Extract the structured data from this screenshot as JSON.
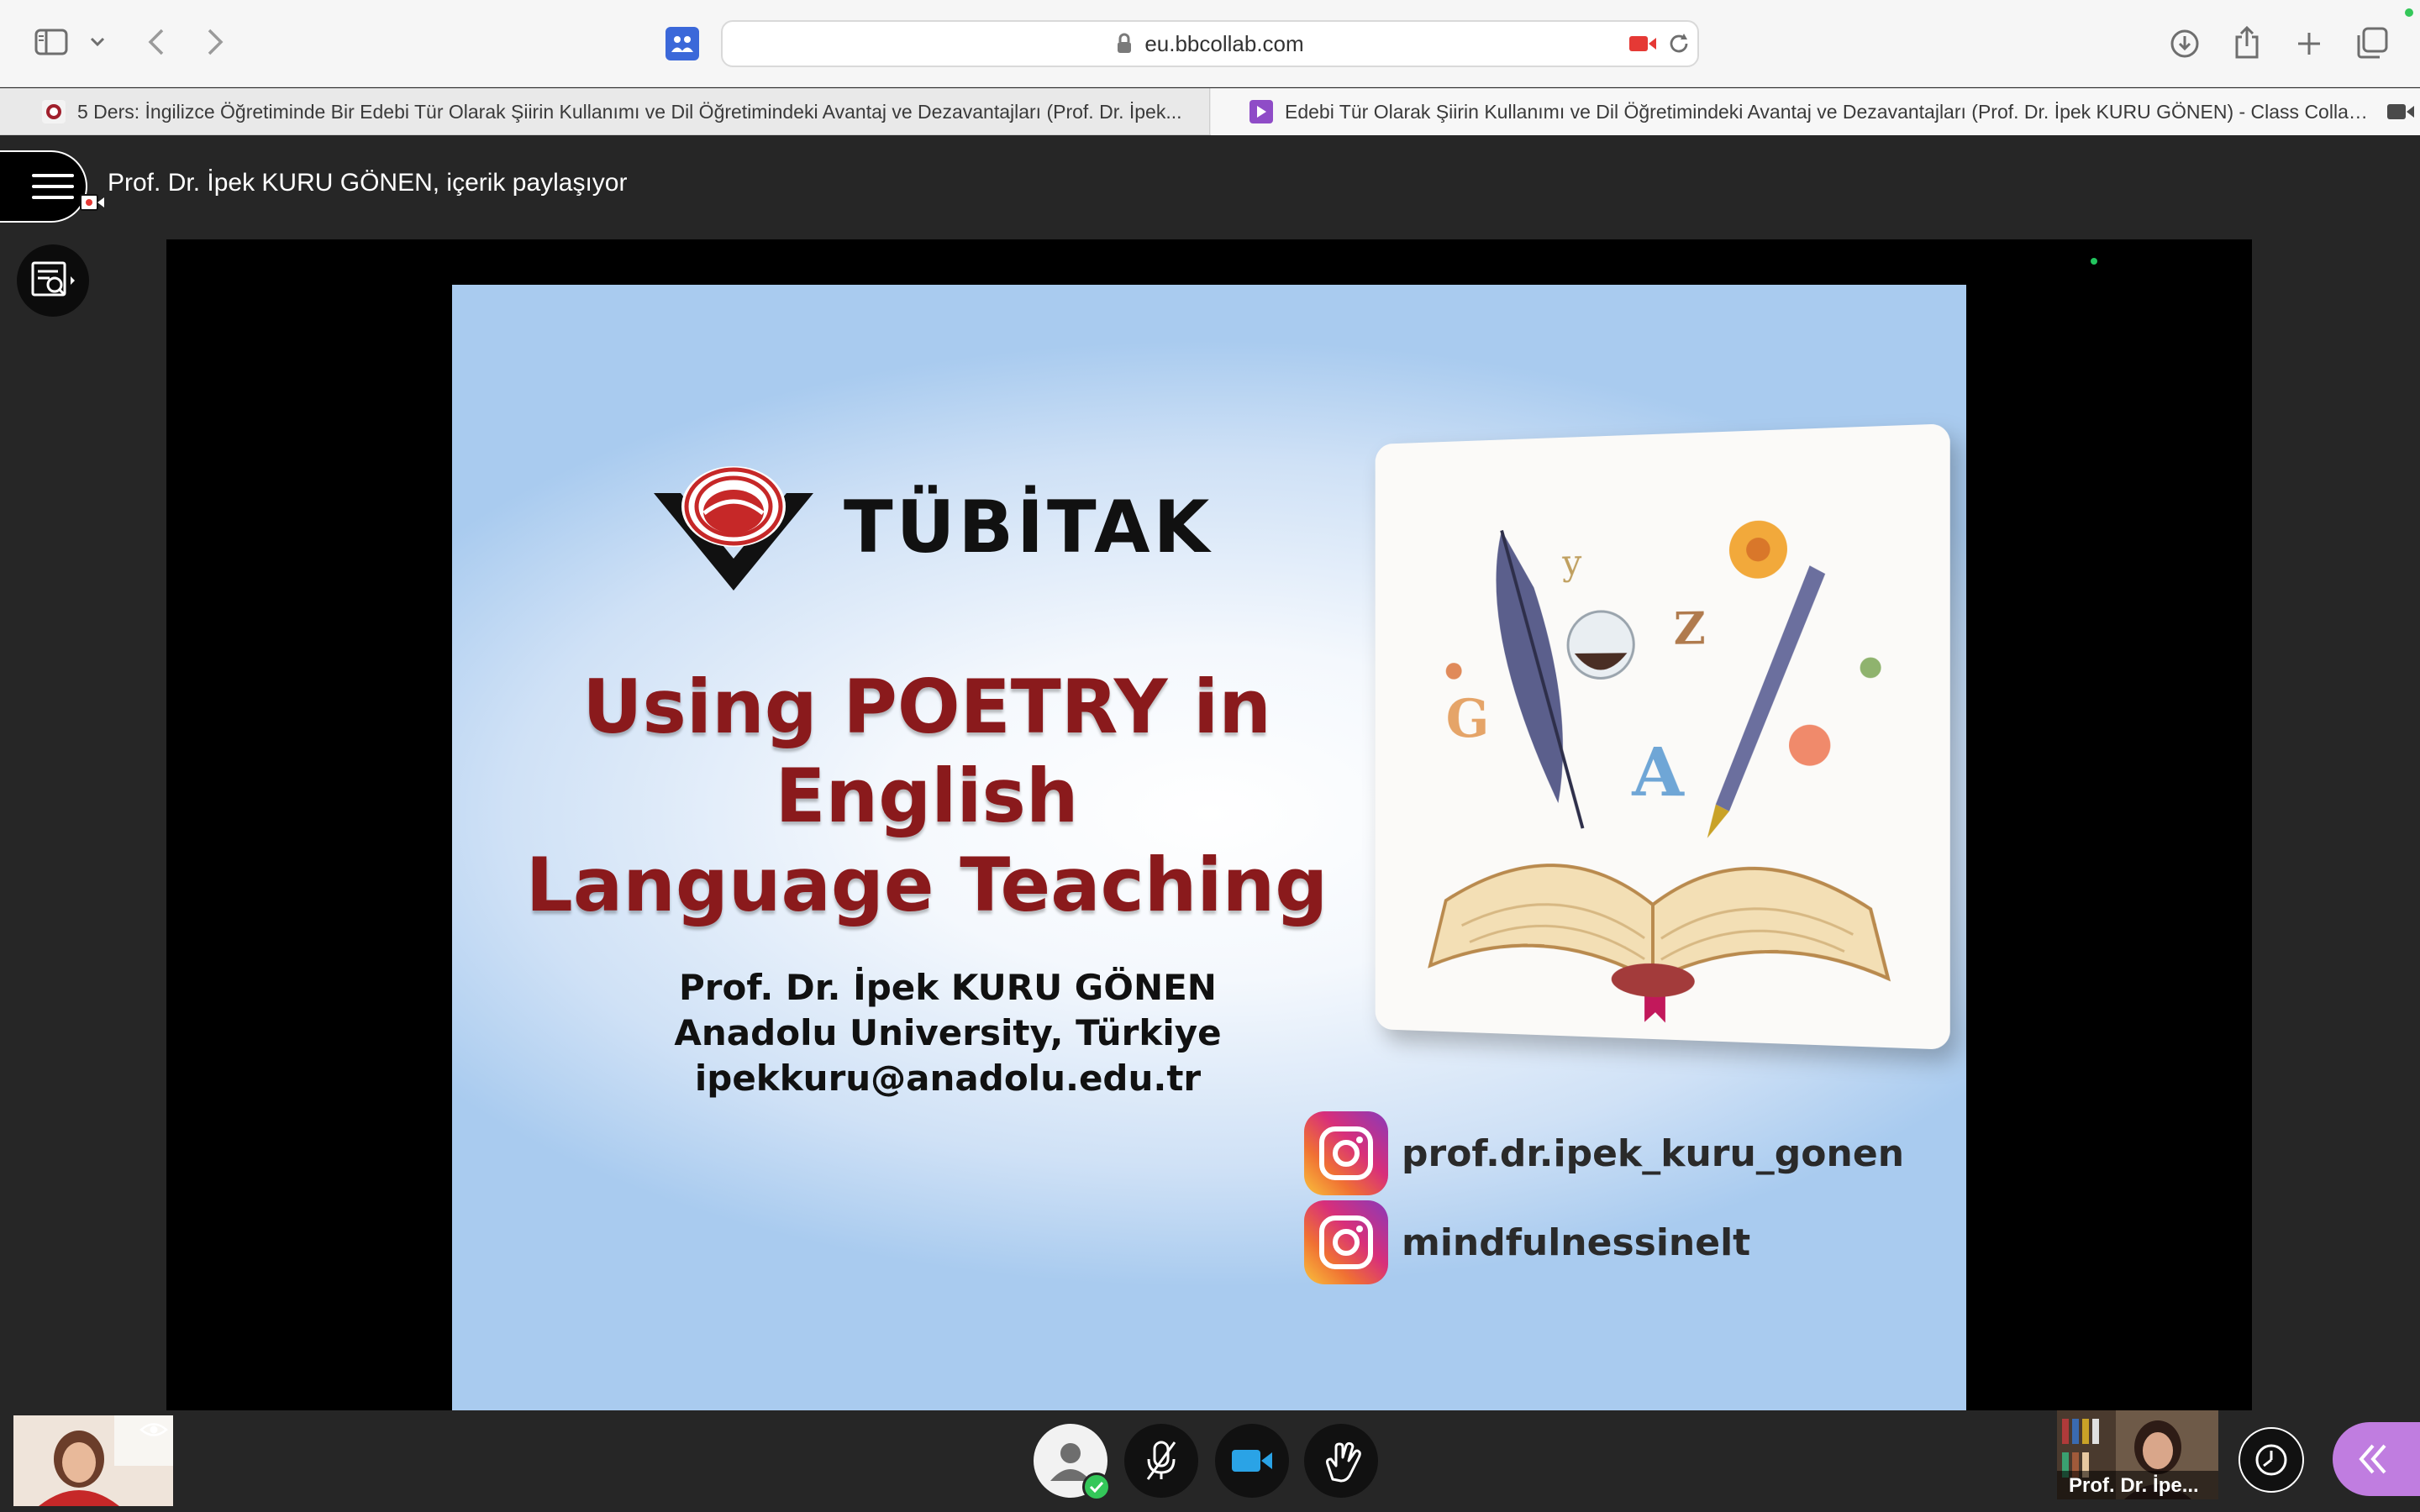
{
  "browser": {
    "url": "eu.bbcollab.com",
    "tabs": [
      {
        "title": "5 Ders: İngilizce Öğretiminde Bir Edebi Tür Olarak Şiirin Kullanımı ve Dil Öğretimindeki Avantaj ve Dezavantajları (Prof. Dr. İpek..."
      },
      {
        "title": "Edebi Tür Olarak Şiirin Kullanımı ve Dil Öğretimindeki Avantaj ve Dezavantajları (Prof. Dr. İpek KURU GÖNEN) - Class Collabora..."
      }
    ]
  },
  "session": {
    "share_status": "Prof. Dr. İpek KURU GÖNEN, içerik paylaşıyor"
  },
  "slide": {
    "logo_text": "TÜBİTAK",
    "title_line1": "Using POETRY in English",
    "title_line2": "Language Teaching",
    "author_name": "Prof. Dr. İpek KURU GÖNEN",
    "author_affiliation": "Anadolu University, Türkiye",
    "author_email": "ipekkuru@anadolu.edu.tr",
    "instagram_1": "prof.dr.ipek_kuru_gonen",
    "instagram_2": "mindfulnessinelt",
    "poster_letters": [
      "G",
      "A",
      "Z",
      "y"
    ]
  },
  "participants": {
    "presenter_name": "Prof. Dr. İpe..."
  },
  "colors": {
    "title_red": "#8a1a1c",
    "collab_purple": "#c07de0",
    "video_blue": "#2aa3e6",
    "status_green": "#34c759"
  }
}
